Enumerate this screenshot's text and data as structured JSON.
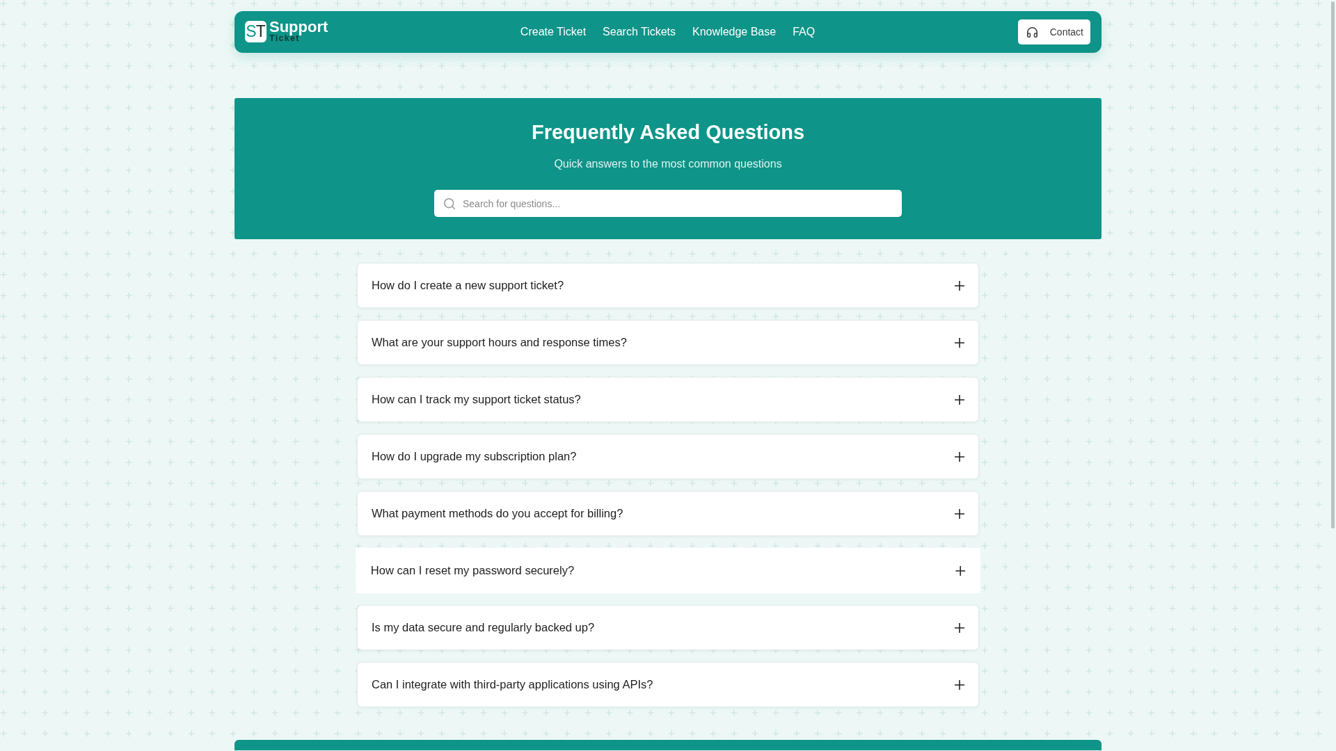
{
  "navbar": {
    "logo": {
      "mark": "ST",
      "title": "Support",
      "subtitle": "Ticket"
    },
    "links": [
      {
        "label": "Create Ticket"
      },
      {
        "label": "Search Tickets"
      },
      {
        "label": "Knowledge Base"
      },
      {
        "label": "FAQ"
      }
    ],
    "contact_button": {
      "label": "Contact"
    }
  },
  "hero": {
    "title": "Frequently Asked Questions",
    "subtitle": "Quick answers to the most common questions",
    "search": {
      "placeholder": "Search for questions..."
    }
  },
  "faq": [
    {
      "question": "How do I create a new support ticket?",
      "expanded": false,
      "hovered": false
    },
    {
      "question": "What are your support hours and response times?",
      "expanded": false,
      "hovered": false
    },
    {
      "question": "How can I track my support ticket status?",
      "expanded": false,
      "hovered": false
    },
    {
      "question": "How do I upgrade my subscription plan?",
      "expanded": false,
      "hovered": false
    },
    {
      "question": "What payment methods do you accept for billing?",
      "expanded": false,
      "hovered": false
    },
    {
      "question": "How can I reset my password securely?",
      "expanded": false,
      "hovered": true
    },
    {
      "question": "Is my data secure and regularly backed up?",
      "expanded": false,
      "hovered": false
    },
    {
      "question": "Can I integrate with third-party applications using APIs?",
      "expanded": false,
      "hovered": false
    }
  ]
}
